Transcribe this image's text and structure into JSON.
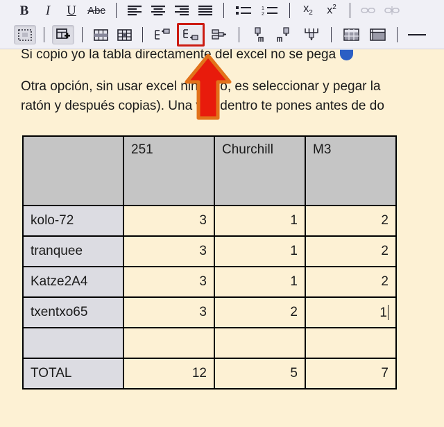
{
  "toolbar": {
    "row1": [
      {
        "name": "bold-button",
        "label": "B",
        "title": "Negrita"
      },
      {
        "name": "italic-button",
        "label": "I",
        "title": "Cursiva"
      },
      {
        "name": "underline-button",
        "label": "U",
        "title": "Subrayado"
      },
      {
        "name": "strikethrough-button",
        "label": "Abc",
        "title": "Tachado"
      },
      {
        "name": "align-left-button",
        "label": "",
        "title": "Alinear a la izquierda"
      },
      {
        "name": "align-center-button",
        "label": "",
        "title": "Centrar"
      },
      {
        "name": "align-right-button",
        "label": "",
        "title": "Alinear a la derecha"
      },
      {
        "name": "align-justify-button",
        "label": "",
        "title": "Justificar"
      },
      {
        "name": "bullet-list-button",
        "label": "",
        "title": "Lista con viñetas"
      },
      {
        "name": "numbered-list-button",
        "label": "",
        "title": "Lista numerada"
      },
      {
        "name": "subscript-button",
        "label": "x2",
        "title": "Subíndice"
      },
      {
        "name": "superscript-button",
        "label": "x2",
        "title": "Superíndice"
      },
      {
        "name": "insert-link-button",
        "label": "",
        "title": "Insertar enlace"
      },
      {
        "name": "remove-link-button",
        "label": "",
        "title": "Quitar enlace"
      }
    ],
    "row2": [
      {
        "name": "table-borders-button",
        "title": "Bordes de tabla"
      },
      {
        "name": "insert-table-button",
        "title": "Insertar tabla"
      },
      {
        "name": "merge-cells-button",
        "title": "Combinar celdas"
      },
      {
        "name": "split-cells-button",
        "title": "Dividir celdas"
      },
      {
        "name": "insert-row-above-button",
        "title": "Insertar fila encima"
      },
      {
        "name": "insert-row-below-button",
        "title": "Insertar fila debajo"
      },
      {
        "name": "delete-row-button",
        "title": "Eliminar fila"
      },
      {
        "name": "insert-column-left-button",
        "title": "Insertar columna a la izquierda"
      },
      {
        "name": "insert-column-right-button",
        "title": "Insertar columna a la derecha"
      },
      {
        "name": "delete-column-button",
        "title": "Eliminar columna"
      },
      {
        "name": "table-properties-button",
        "title": "Propiedades de tabla"
      },
      {
        "name": "cell-properties-button",
        "title": "Propiedades de celda"
      },
      {
        "name": "horizontal-rule-button",
        "title": "Línea horizontal"
      }
    ],
    "highlight_color": "#cc1b12",
    "highlighted_button": "insert-row-below-button"
  },
  "document": {
    "paragraph1": "Si copio yo la tabla directamente del excel no se pega",
    "paragraph2": "Otra opción, sin usar excel ninguno, es seleccionar y pegar la",
    "paragraph3": "ratón y después copias). Una vez dentro te pones antes de do",
    "emoji": "blue-smiley-emoji",
    "page_background": "#fdf1d4"
  },
  "table": {
    "headers": [
      "",
      "251",
      "Churchill",
      "M3"
    ],
    "rows": [
      {
        "label": "kolo-72",
        "values": [
          "3",
          "1",
          "2"
        ]
      },
      {
        "label": "tranquee",
        "values": [
          "3",
          "1",
          "2"
        ]
      },
      {
        "label": "Katze2A4",
        "values": [
          "3",
          "1",
          "2"
        ]
      },
      {
        "label": "txentxo65",
        "values": [
          "3",
          "2",
          "1"
        ]
      },
      {
        "label": "",
        "values": [
          "",
          "",
          ""
        ]
      },
      {
        "label": "TOTAL",
        "values": [
          "12",
          "5",
          "7"
        ]
      }
    ],
    "header_bg": "#c5c5c5",
    "label_bg": "#dcdce2",
    "cell_bg": "#fdf1d4",
    "caret_row": 3,
    "caret_column": 3
  },
  "annotation": {
    "name": "red-up-arrow",
    "fill": "#e81b0c",
    "stroke": "#e2721a",
    "points_to": "insert-row-below-button"
  }
}
